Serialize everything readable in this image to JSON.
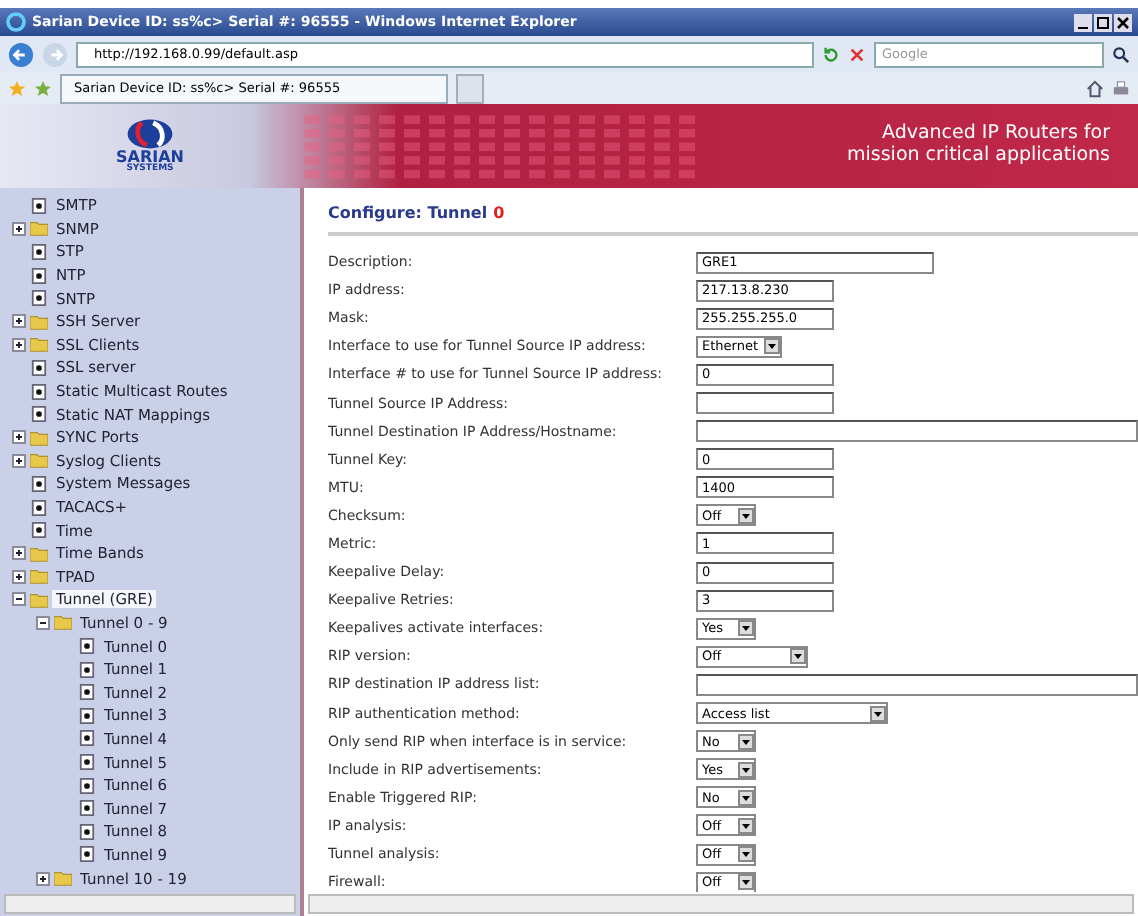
{
  "window": {
    "title": "Sarian Device ID: ss%c> Serial #: 96555 - Windows Internet Explorer"
  },
  "address_bar": {
    "url": "http://192.168.0.99/default.asp"
  },
  "search": {
    "placeholder": "Google"
  },
  "tabs": [
    {
      "label": "Sarian Device ID: ss%c> Serial #: 96555",
      "selected": true
    }
  ],
  "header": {
    "logo_name": "SARIAN",
    "logo_sub": "SYSTEMS",
    "tagline": [
      "Advanced IP Routers for",
      "mission critical applications"
    ]
  },
  "sidebar": {
    "items": [
      {
        "label": "SMTP",
        "kind": "page",
        "selected": false
      },
      {
        "label": "SNMP",
        "kind": "folder",
        "expanded": false,
        "selected": false
      },
      {
        "label": "STP",
        "kind": "page",
        "selected": false
      },
      {
        "label": "NTP",
        "kind": "page",
        "selected": false
      },
      {
        "label": "SNTP",
        "kind": "page",
        "selected": false
      },
      {
        "label": "SSH Server",
        "kind": "folder",
        "expanded": false,
        "selected": false
      },
      {
        "label": "SSL Clients",
        "kind": "folder",
        "expanded": false,
        "selected": false
      },
      {
        "label": "SSL server",
        "kind": "page",
        "selected": false
      },
      {
        "label": "Static Multicast Routes",
        "kind": "page",
        "selected": false
      },
      {
        "label": "Static NAT Mappings",
        "kind": "page",
        "selected": false
      },
      {
        "label": "SYNC Ports",
        "kind": "folder",
        "expanded": false,
        "selected": false
      },
      {
        "label": "Syslog Clients",
        "kind": "folder",
        "expanded": false,
        "selected": false
      },
      {
        "label": "System Messages",
        "kind": "page",
        "selected": false
      },
      {
        "label": "TACACS+",
        "kind": "page",
        "selected": false
      },
      {
        "label": "Time",
        "kind": "page",
        "selected": false
      },
      {
        "label": "Time Bands",
        "kind": "folder",
        "expanded": false,
        "selected": false
      },
      {
        "label": "TPAD",
        "kind": "folder",
        "expanded": false,
        "selected": false
      },
      {
        "label": "Tunnel (GRE)",
        "kind": "folder",
        "expanded": true,
        "selected": true,
        "children": [
          {
            "label": "Tunnel 0 - 9",
            "kind": "folder",
            "expanded": true,
            "selected": false,
            "children": [
              {
                "label": "Tunnel 0",
                "kind": "page",
                "selected": false
              },
              {
                "label": "Tunnel 1",
                "kind": "page",
                "selected": false
              },
              {
                "label": "Tunnel 2",
                "kind": "page",
                "selected": false
              },
              {
                "label": "Tunnel 3",
                "kind": "page",
                "selected": false
              },
              {
                "label": "Tunnel 4",
                "kind": "page",
                "selected": false
              },
              {
                "label": "Tunnel 5",
                "kind": "page",
                "selected": false
              },
              {
                "label": "Tunnel 6",
                "kind": "page",
                "selected": false
              },
              {
                "label": "Tunnel 7",
                "kind": "page",
                "selected": false
              },
              {
                "label": "Tunnel 8",
                "kind": "page",
                "selected": false
              },
              {
                "label": "Tunnel 9",
                "kind": "page",
                "selected": false
              }
            ]
          },
          {
            "label": "Tunnel 10 - 19",
            "kind": "folder",
            "expanded": false,
            "selected": false
          }
        ]
      }
    ]
  },
  "form": {
    "title": "Configure: Tunnel",
    "number": "0",
    "fields": [
      {
        "label": "Description:",
        "kind": "longfield",
        "value": "GRE1"
      },
      {
        "label": "IP address:",
        "kind": "field",
        "value": "217.13.8.230"
      },
      {
        "label": "Mask:",
        "kind": "field",
        "value": "255.255.255.0"
      },
      {
        "label": "Interface to use for Tunnel Source IP address:",
        "kind": "dropdown",
        "value": "Ethernet"
      },
      {
        "label": "Interface # to use for Tunnel Source IP address:",
        "kind": "field",
        "value": "0"
      },
      {
        "label": "Tunnel Source IP Address:",
        "kind": "field"
      },
      {
        "label": "Tunnel Destination IP Address/Hostname:",
        "kind": "fullfield"
      },
      {
        "label": "Tunnel Key:",
        "kind": "field",
        "value": "0"
      },
      {
        "label": "MTU:",
        "kind": "field",
        "value": "1400"
      },
      {
        "label": "Checksum:",
        "kind": "dropdown",
        "value": "Off"
      },
      {
        "label": "Metric:",
        "kind": "field",
        "value": "1"
      },
      {
        "label": "Keepalive Delay:",
        "kind": "field",
        "value": "0"
      },
      {
        "label": "Keepalive Retries:",
        "kind": "field",
        "value": "3"
      },
      {
        "label": "Keepalives activate interfaces:",
        "kind": "dropdown",
        "value": "Yes"
      },
      {
        "label": "RIP version:",
        "kind": "mediumdropdown",
        "value": "Off"
      },
      {
        "label": "RIP destination IP address list:",
        "kind": "fullfield"
      },
      {
        "label": "RIP authentication method:",
        "kind": "longdropdown",
        "value": "Access list"
      },
      {
        "label": "Only send RIP when interface is in service:",
        "kind": "dropdown",
        "value": "No"
      },
      {
        "label": "Include in RIP advertisements:",
        "kind": "dropdown",
        "value": "Yes"
      },
      {
        "label": "Enable Triggered RIP:",
        "kind": "dropdown",
        "value": "No"
      },
      {
        "label": "IP analysis:",
        "kind": "dropdown",
        "value": "Off"
      },
      {
        "label": "Tunnel analysis:",
        "kind": "dropdown",
        "value": "Off"
      },
      {
        "label": "Firewall:",
        "kind": "dropdown",
        "value": "Off"
      }
    ]
  }
}
